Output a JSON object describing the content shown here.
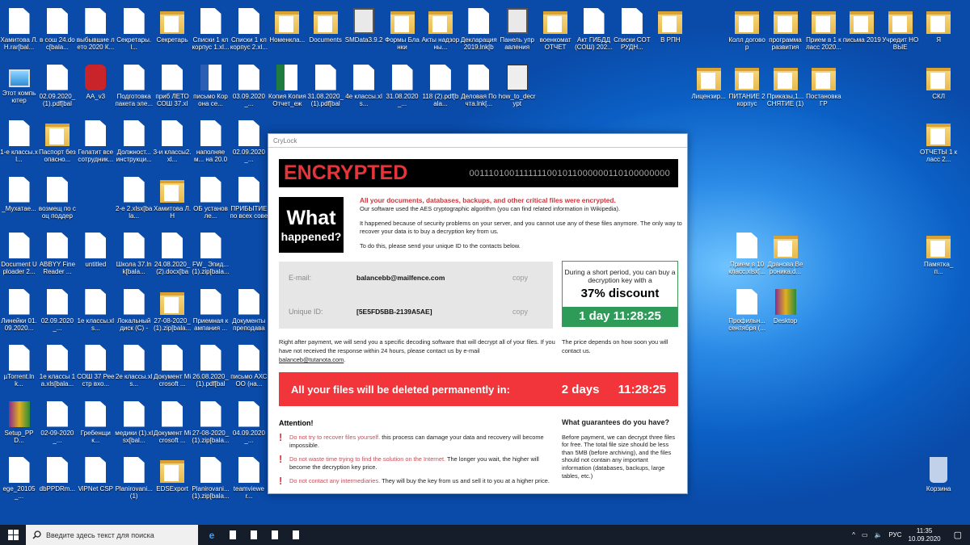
{
  "desktop_icons": [
    {
      "label": "Хамитова Л.Н.rar[bal...",
      "type": "doc"
    },
    {
      "label": "в сош 24.doc[bala...",
      "type": "doc"
    },
    {
      "label": "выбывшие лето 2020 К...",
      "type": "doc"
    },
    {
      "label": "Секретары.l...",
      "type": "doc"
    },
    {
      "label": "Секретарь",
      "type": "folder"
    },
    {
      "label": "Списки 1 кл корпус 1.xl...",
      "type": "doc"
    },
    {
      "label": "Списки 1 кл корпус 2.xl...",
      "type": "doc"
    },
    {
      "label": "Номенкла...",
      "type": "folder"
    },
    {
      "label": "Documents",
      "type": "folder"
    },
    {
      "label": "SMData3.9.2",
      "type": "app"
    },
    {
      "label": "Формы Бланки",
      "type": "folder"
    },
    {
      "label": "Акты надзорны...",
      "type": "folder"
    },
    {
      "label": "Декларация 2019.lnk[ba...",
      "type": "doc"
    },
    {
      "label": "Панель управления",
      "type": "app"
    },
    {
      "label": "военкомат ОТЧЕТ",
      "type": "folder"
    },
    {
      "label": "Акт ГИБДД (СОШ) 202...",
      "type": "doc"
    },
    {
      "label": "Списки СОТРУДН...",
      "type": "doc"
    },
    {
      "label": "В РПН",
      "type": "folder"
    },
    {
      "label": "Колл договор",
      "type": "folder"
    },
    {
      "label": "программа развития",
      "type": "folder"
    },
    {
      "label": "Прием в 1 класс 2020...",
      "type": "folder"
    },
    {
      "label": "письма 2019",
      "type": "folder"
    },
    {
      "label": "Учредит НОВЫЕ",
      "type": "folder"
    },
    {
      "label": "Я",
      "type": "folder"
    },
    {
      "label": "Этот компьютер",
      "type": "pc"
    },
    {
      "label": "02.09.2020_ (1).pdf[bala...",
      "type": "doc"
    },
    {
      "label": "AA_v3",
      "type": "red"
    },
    {
      "label": "Подготовка пакета эле...",
      "type": "doc"
    },
    {
      "label": "приб ЛЕТО СОШ 37.xls...",
      "type": "doc"
    },
    {
      "label": "письмо Корона се...",
      "type": "word"
    },
    {
      "label": "03.09.2020_...",
      "type": "doc"
    },
    {
      "label": "Копия Копия Отчет_еже...",
      "type": "xls"
    },
    {
      "label": "31.08.2020_ (1).pdf[bala...",
      "type": "doc"
    },
    {
      "label": "4е классы.xls...",
      "type": "doc"
    },
    {
      "label": "31.08.2020_...",
      "type": "doc"
    },
    {
      "label": "118 (2).pdf[bala...",
      "type": "doc"
    },
    {
      "label": "Деловая Почта.lnk[...",
      "type": "doc"
    },
    {
      "label": "how_to_decrypt",
      "type": "win"
    },
    {
      "label": "Лицензир...",
      "type": "folder"
    },
    {
      "label": "ПИТАНИЕ 2 корпус",
      "type": "folder"
    },
    {
      "label": "Приказы,1... СНЯТИЕ (1)",
      "type": "folder"
    },
    {
      "label": "Постановка ГР",
      "type": "folder"
    },
    {
      "label": "СКЛ",
      "type": "folder"
    },
    {
      "label": "1-е классы.xl...",
      "type": "doc"
    },
    {
      "label": "Паспорт безопасно...",
      "type": "folder"
    },
    {
      "label": "Гелатит все сотрудник...",
      "type": "doc"
    },
    {
      "label": "Должност... инструкци...",
      "type": "doc"
    },
    {
      "label": "3-и классы2.xl...",
      "type": "doc"
    },
    {
      "label": "наполняем... на 20.08.20...",
      "type": "doc"
    },
    {
      "label": "02.09.2020_...",
      "type": "doc"
    },
    {
      "label": "ОТЧЕТЫ 1 класс 2...",
      "type": "folder"
    },
    {
      "label": "_Мухатае...",
      "type": "doc"
    },
    {
      "label": "возмещ по соц поддерж...",
      "type": "doc"
    },
    {
      "label": "2-е 2.xlsx[bala...",
      "type": "doc"
    },
    {
      "label": "Хамитова Л.Н",
      "type": "folder"
    },
    {
      "label": "ОБ установле...",
      "type": "doc"
    },
    {
      "label": "ПРИБЫТИЕ по всех советі...",
      "type": "doc"
    },
    {
      "label": "Document Uploader 2...",
      "type": "doc"
    },
    {
      "label": "ABBYY FineReader ...",
      "type": "doc"
    },
    {
      "label": "untitled",
      "type": "doc"
    },
    {
      "label": "Школа 37.lnk[bala...",
      "type": "doc"
    },
    {
      "label": "24.08.2020_ (2).docx[bal...",
      "type": "doc"
    },
    {
      "label": "FW_ Эпид... (1).zip[bala...",
      "type": "doc"
    },
    {
      "label": "Прием в 10 класс.xlsx[...",
      "type": "doc"
    },
    {
      "label": "Дранова Вероника.d...",
      "type": "folder"
    },
    {
      "label": "Памятка_п...",
      "type": "folder"
    },
    {
      "label": "Линейки 01.09.2020...",
      "type": "doc"
    },
    {
      "label": "02.09.2020_...",
      "type": "doc"
    },
    {
      "label": "1е классы.xls...",
      "type": "doc"
    },
    {
      "label": "Локальный диск (C) - Я...",
      "type": "doc"
    },
    {
      "label": "27-08-2020_ (1).zip[bala...",
      "type": "folder"
    },
    {
      "label": "Приемная кампания ...",
      "type": "doc"
    },
    {
      "label": "Документы преподават...",
      "type": "doc"
    },
    {
      "label": "Профильн... сентября (...",
      "type": "doc"
    },
    {
      "label": "Desktop",
      "type": "rar"
    },
    {
      "label": "µTorrent.lnk...",
      "type": "doc"
    },
    {
      "label": "1е классы 1а.xls[bala...",
      "type": "doc"
    },
    {
      "label": "СОШ 37 Реестр вхо...",
      "type": "doc"
    },
    {
      "label": "2е классы.xls...",
      "type": "doc"
    },
    {
      "label": "Документ Microsoft ...",
      "type": "doc"
    },
    {
      "label": "26.08.2020_ (1).pdf[bala...",
      "type": "doc"
    },
    {
      "label": "письмо АХСОО (на...",
      "type": "doc"
    },
    {
      "label": "Setup_PPD...",
      "type": "rar"
    },
    {
      "label": "02-09-2020_...",
      "type": "doc"
    },
    {
      "label": "Гребенщик...",
      "type": "doc"
    },
    {
      "label": "медики (1).xlsx[bal...",
      "type": "doc"
    },
    {
      "label": "Документ Microsoft ...",
      "type": "doc"
    },
    {
      "label": "27-08-2020_ (1).zip[bala...",
      "type": "doc"
    },
    {
      "label": "04.09.2020_...",
      "type": "doc"
    },
    {
      "label": "ege_20105_...",
      "type": "doc"
    },
    {
      "label": "dbPPDRm...",
      "type": "doc"
    },
    {
      "label": "ViPNet CSP",
      "type": "doc"
    },
    {
      "label": "Planirovani... (1)",
      "type": "doc"
    },
    {
      "label": "EDSExport",
      "type": "folder"
    },
    {
      "label": "Planirovani... (1).zip[bala...",
      "type": "doc"
    },
    {
      "label": "teamviewer...",
      "type": "doc"
    },
    {
      "label": "Корзина",
      "type": "bin"
    }
  ],
  "dialog": {
    "title": "CryLock",
    "header": "ENCRYPTED",
    "bits": "0011101001111111001011000000110100000000",
    "what_1": "What",
    "what_2": "happened?",
    "intro_heading": "All your documents, databases, backups, and other critical files were encrypted.",
    "intro_1": "Our software used the AES cryptographic algorithm (you can find related information in Wikipedia).",
    "intro_2": "It happened because of security problems on your server, and you cannot use any of these files anymore. The only way to recover your data is to buy a decryption key from us.",
    "intro_3": "To do this, please send your unique ID to the contacts below.",
    "email_label": "E-mail:",
    "email_value": "balancebb@mailfence.com",
    "id_label": "Unique ID:",
    "id_value": "[5E5FD5BB-2139A5AE]",
    "copy_label": "copy",
    "discount_text": "During a short period, you can buy a decryption key with a",
    "discount": "37% discount",
    "discount_timer": "1 day 11:28:25",
    "pay_text": "Right after payment, we will send you a specific decoding software that will decrypt all of your files. If you have not received the response within 24 hours, please contact us by e-mail",
    "pay_email": "balanceb@tutanota.com",
    "price_text": "The price depends on how soon you will contact us.",
    "delete_msg": "All your files will be deleted permanently in:",
    "delete_days": "2 days",
    "delete_time": "11:28:25",
    "attention_title": "Attention!",
    "warnings": [
      {
        "red": "Do not try to recover files yourself.",
        "text": " this process can damage your data and recovery will become impossible."
      },
      {
        "red": "Do not waste time trying to find the solution on the Internet.",
        "text": " The longer you wait, the higher will become the decryption key price."
      },
      {
        "red": "Do not contact any intermediaries.",
        "text": " They will buy the key from us and sell it to you at a higher price."
      }
    ],
    "guarantee_title": "What guarantees do you have?",
    "guarantee_text": "Before payment, we can decrypt three files for free. The total file size should be less than 5MB (before archiving), and the files should not contain any important information (databases, backups, large tables, etc.)"
  },
  "taskbar": {
    "search_placeholder": "Введите здесь текст для поиска",
    "lang": "РУС",
    "time": "11:35",
    "date": "10.09.2020"
  }
}
